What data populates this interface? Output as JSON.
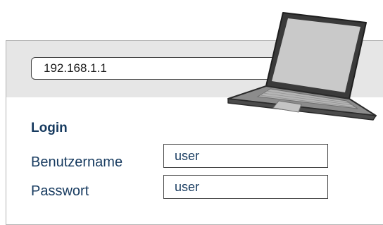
{
  "browser": {
    "url_value": "192.168.1.1"
  },
  "login": {
    "title": "Login",
    "username_label": "Benutzername",
    "username_value": "user",
    "password_label": "Passwort",
    "password_value": "user"
  },
  "icons": {
    "laptop": "laptop-icon"
  },
  "colors": {
    "text_primary": "#163a5f",
    "address_bar_bg": "#e6e6e6",
    "border": "#444444"
  }
}
